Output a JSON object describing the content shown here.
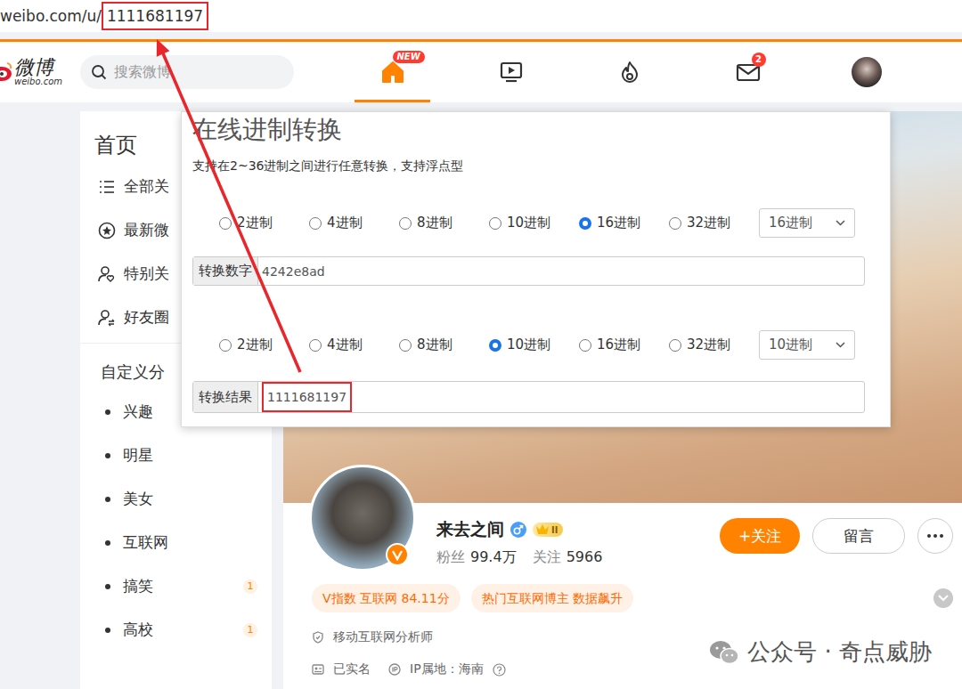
{
  "browser": {
    "url_prefix": "weibo.com/u/",
    "url_id": "1111681197",
    "url_id_highlighted": true
  },
  "header": {
    "logo": "微博",
    "logo_sub": "weibo.com",
    "search": {
      "placeholder": "搜索微博"
    },
    "nav": [
      {
        "kind": "home",
        "selected": true,
        "badge": "NEW"
      },
      {
        "kind": "video",
        "selected": false,
        "badge": ""
      },
      {
        "kind": "hot",
        "selected": false,
        "badge": ""
      },
      {
        "kind": "mail",
        "selected": false,
        "badge": "2"
      },
      {
        "kind": "avatar",
        "selected": false,
        "badge": ""
      }
    ]
  },
  "sidebar": {
    "title": "首页",
    "items": [
      {
        "label": "全部关",
        "kind": "list"
      },
      {
        "label": "最新微",
        "kind": "new"
      },
      {
        "label": "特别关",
        "kind": "special"
      },
      {
        "label": "好友圈",
        "kind": "friends"
      }
    ],
    "group_title": "自定义分",
    "groups": [
      {
        "label": "兴趣",
        "badge": ""
      },
      {
        "label": "明星",
        "badge": ""
      },
      {
        "label": "美女",
        "badge": ""
      },
      {
        "label": "互联网",
        "badge": ""
      },
      {
        "label": "搞笑",
        "badge": "1"
      },
      {
        "label": "高校",
        "badge": "1"
      }
    ]
  },
  "converter": {
    "title": "在线进制转换",
    "subtitle": "支持在2~36进制之间进行任意转换，支持浮点型",
    "rows": [
      {
        "options": [
          {
            "label": "2进制",
            "selected": false
          },
          {
            "label": "4进制",
            "selected": false
          },
          {
            "label": "8进制",
            "selected": false
          },
          {
            "label": "10进制",
            "selected": false
          },
          {
            "label": "16进制",
            "selected": true
          },
          {
            "label": "32进制",
            "selected": false
          }
        ],
        "select": "16进制",
        "field_label": "转换数字",
        "value": "4242e8ad",
        "highlighted": false
      },
      {
        "options": [
          {
            "label": "2进制",
            "selected": false
          },
          {
            "label": "4进制",
            "selected": false
          },
          {
            "label": "8进制",
            "selected": false
          },
          {
            "label": "10进制",
            "selected": true
          },
          {
            "label": "16进制",
            "selected": false
          },
          {
            "label": "32进制",
            "selected": false
          }
        ],
        "select": "10进制",
        "field_label": "转换结果",
        "value": "1111681197",
        "highlighted": true
      }
    ]
  },
  "profile": {
    "name": "来去之间",
    "gender": "male",
    "level_badge": "II",
    "verified": true,
    "stats": [
      {
        "label": "粉丝",
        "value": "99.4万"
      },
      {
        "label": "关注",
        "value": "5966"
      }
    ],
    "buttons": [
      {
        "label": "+关注",
        "kind": "primary"
      },
      {
        "label": "留言",
        "kind": "outline"
      }
    ],
    "tags": [
      {
        "text": "V指数 互联网 84.11分"
      },
      {
        "text": "热门互联网博主 数据飙升"
      }
    ],
    "info_lines": [
      {
        "items": [
          {
            "kind": "job",
            "text": "移动互联网分析师"
          }
        ]
      },
      {
        "items": [
          {
            "kind": "realname",
            "text": "已实名"
          },
          {
            "kind": "ip",
            "text": "IP属地：海南"
          }
        ]
      }
    ]
  },
  "watermark": {
    "text": "公众号 · 奇点威胁"
  }
}
